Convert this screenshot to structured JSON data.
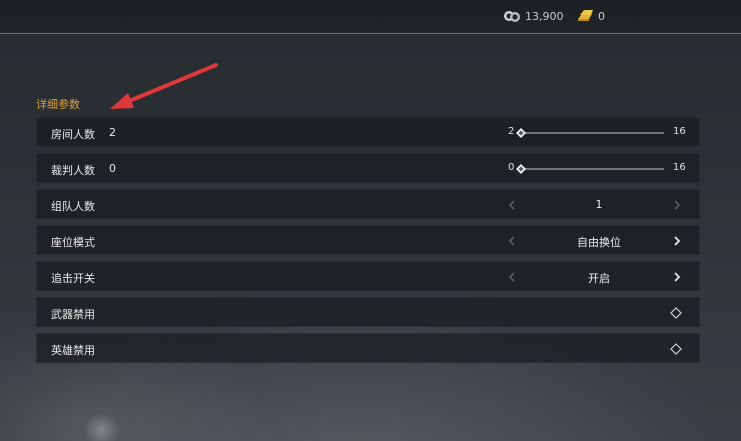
{
  "header": {
    "coins": "13,900",
    "gold": "0",
    "coin_icon": "coin-stack-icon",
    "gold_icon": "gold-bar-icon"
  },
  "section": {
    "title": "详细参数",
    "title_color": "#d9a240"
  },
  "annotation": {
    "arrow_color": "#e0383a"
  },
  "settings": [
    {
      "label": "房间人数",
      "value": "2",
      "min": "2",
      "max": "16",
      "level": 0
    },
    {
      "label": "裁判人数",
      "value": "0",
      "min": "0",
      "max": "16",
      "level": 0
    },
    {
      "label": "组队人数",
      "value": "1"
    },
    {
      "label": "座位模式",
      "value": "自由换位"
    },
    {
      "label": "追击开关",
      "value": "开启"
    },
    {
      "label": "武器禁用"
    },
    {
      "label": "英雄禁用"
    }
  ]
}
